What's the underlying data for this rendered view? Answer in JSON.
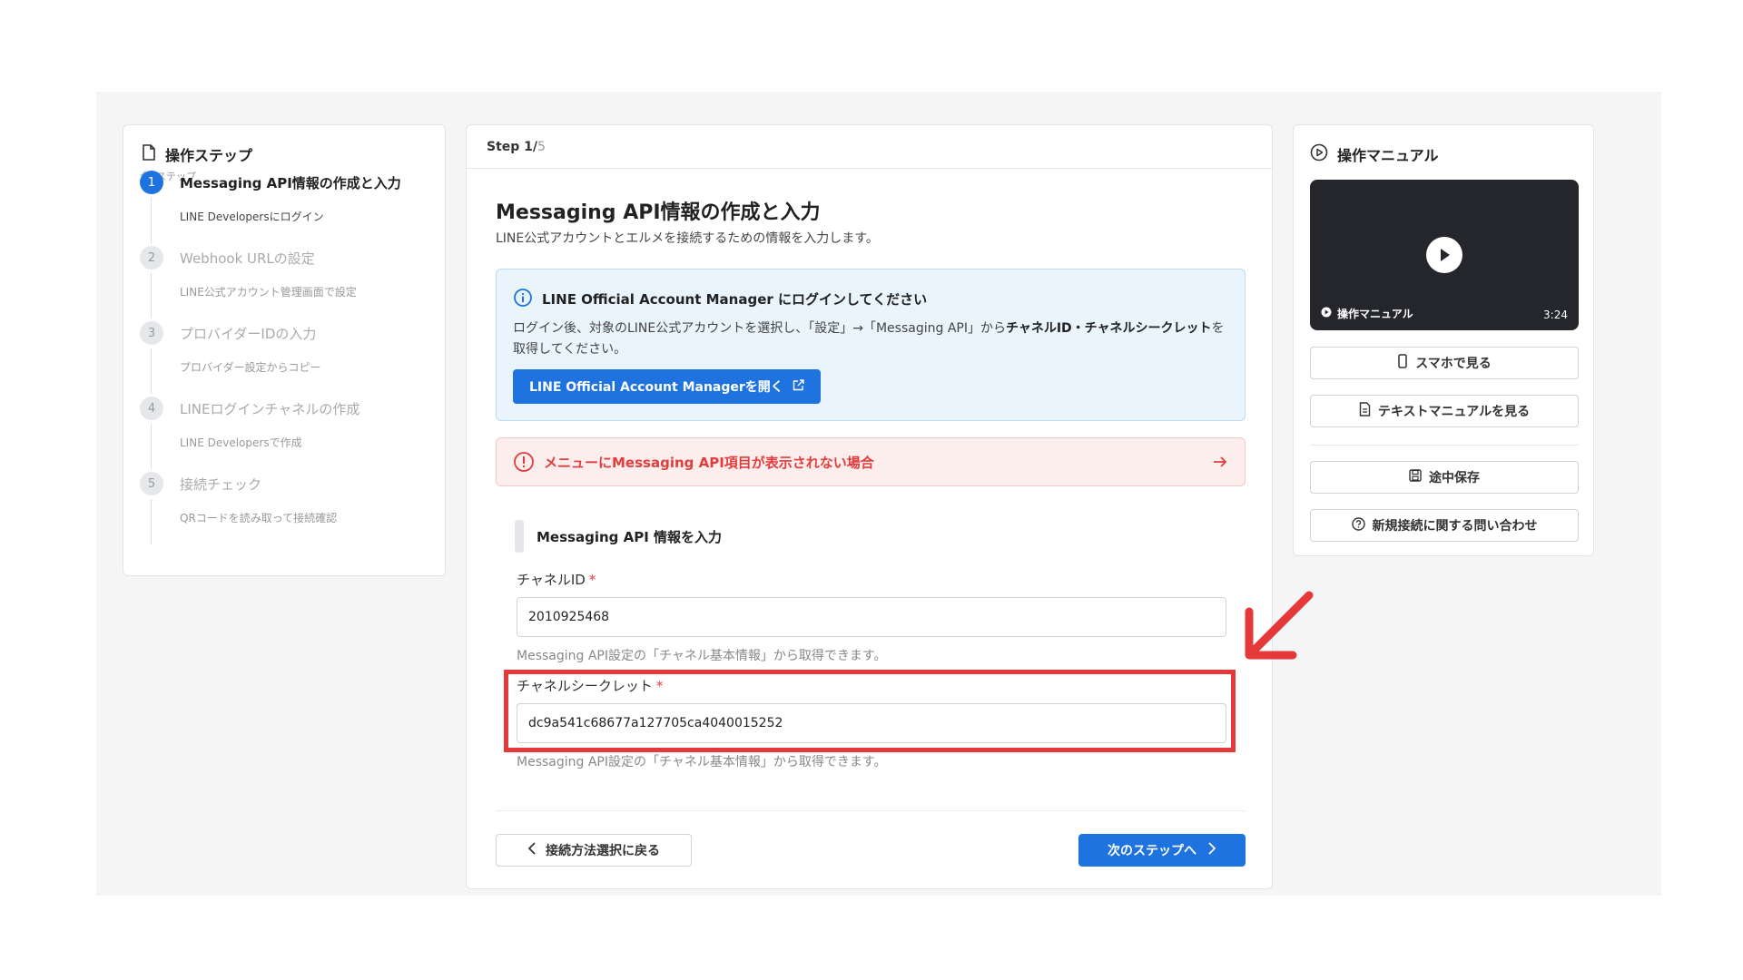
{
  "sidebar": {
    "title": "操作ステップ",
    "subtitle": "全5ステップ",
    "steps": [
      {
        "num": "1",
        "title": "Messaging API情報の作成と入力",
        "desc": "LINE Developersにログイン"
      },
      {
        "num": "2",
        "title": "Webhook URLの設定",
        "desc": "LINE公式アカウント管理画面で設定"
      },
      {
        "num": "3",
        "title": "プロバイダーIDの入力",
        "desc": "プロバイダー設定からコピー"
      },
      {
        "num": "4",
        "title": "LINEログインチャネルの作成",
        "desc": "LINE Developersで作成"
      },
      {
        "num": "5",
        "title": "接続チェック",
        "desc": "QRコードを読み取って接続確認"
      }
    ]
  },
  "main": {
    "step_current": "Step 1/",
    "step_total": "5",
    "title": "Messaging API情報の作成と入力",
    "lead": "LINE公式アカウントとエルメを接続するための情報を入力します。",
    "info": {
      "title": "LINE Official Account Manager にログインしてください",
      "body_1": "ログイン後、対象のLINE公式アカウントを選択し、「設定」→「Messaging API」から",
      "body_bold": "チャネルID・チャネルシークレット",
      "body_2": "を取得してください。",
      "button": "LINE Official Account Managerを開く"
    },
    "alert": "メニューにMessaging API項目が表示されない場合",
    "section_title": "Messaging API 情報を入力",
    "channel_id": {
      "label": "チャネルID",
      "required": "*",
      "value": "2010925468",
      "hint": "Messaging API設定の「チャネル基本情報」から取得できます。"
    },
    "channel_secret": {
      "label": "チャネルシークレット",
      "required": "*",
      "value": "dc9a541c68677a127705ca4040015252",
      "hint": "Messaging API設定の「チャネル基本情報」から取得できます。"
    },
    "back_button": "接続方法選択に戻る",
    "next_button": "次のステップへ"
  },
  "manual": {
    "title": "操作マニュアル",
    "video_caption": "操作マニュアル",
    "video_duration": "3:24",
    "phone_button": "スマホで見る",
    "text_button": "テキストマニュアルを見る",
    "save_button": "途中保存",
    "contact_button": "新規接続に関する問い合わせ"
  },
  "colors": {
    "accent": "#1f73e0",
    "alert": "#e23c3c",
    "highlight": "#e53838"
  }
}
